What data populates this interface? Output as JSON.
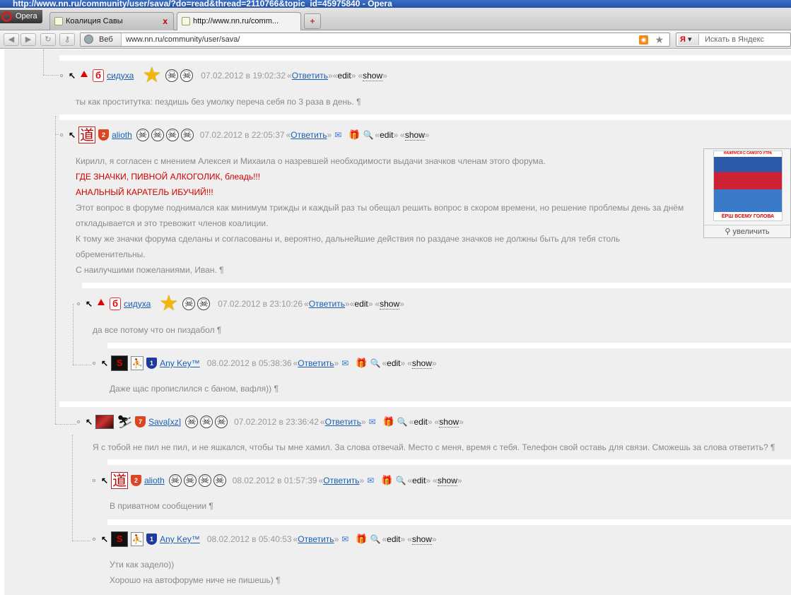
{
  "window": {
    "title": "http://www.nn.ru/community/user/sava/?do=read&thread=2110766&topic_id=45975840 - Opera"
  },
  "browser": {
    "opera_label": "Opera",
    "tabs": [
      {
        "label": "Коалиция Савы"
      },
      {
        "label": "http://www.nn.ru/comm..."
      }
    ],
    "tab_close": "x",
    "newtab": "+",
    "web_label": "Веб",
    "url": "www.nn.ru/community/user/sava/",
    "search_engine": "Я",
    "search_placeholder": "Искать в Яндекс"
  },
  "labels": {
    "reply": "Ответить",
    "edit": "edit",
    "show": "show",
    "q_open": "«",
    "q_close": "»",
    "pilcrow": "¶",
    "enlarge": "увеличить"
  },
  "posts": [
    {
      "author": "сидуха",
      "date": "07.02.2012 в 19:02:32",
      "lines": [
        "ты как проститутка: пездишь без умолку переча себя по 3 раза в день. ¶"
      ]
    },
    {
      "author": "alioth",
      "date": "07.02.2012 в 22:05:37",
      "lines": [
        "Кирилл, я согласен с мнением Алексея и Михаила о назревшей необходимости выдачи значков членам этого форума.",
        "ГДЕ ЗНАЧКИ, ПИВНОЙ АЛКОГОЛИК, блеадь!!!",
        "АНАЛЬНЫЙ КАРАТЕЛЬ ИБУЧИЙ!!!",
        "Этот вопрос в форуме поднимался как минимум трижды и каждый раз ты обещал решить вопрос в скором времени, но решение проблемы день за днём",
        "откладывается и это тревожит членов коалиции.",
        "К тому же значки форума сделаны и согласованы и, вероятно, дальнейшие действия по раздаче значков не должны быть для тебя столь",
        "обременительны.",
        "С наилучшими пожеланиями, Иван. ¶"
      ]
    },
    {
      "author": "сидуха",
      "date": "07.02.2012 в 23:10:26",
      "lines": [
        "да все потому что он пиздабол ¶"
      ]
    },
    {
      "author": "Any Key™",
      "date": "08.02.2012 в 05:38:36",
      "lines": [
        "Даже щас пропислился с баном, вафля)) ¶"
      ]
    },
    {
      "author": "Sava[xz]",
      "date": "07.02.2012 в 23:36:42",
      "lines": [
        "Я с тобой не пил не пил, и не яшкался, чтобы ты мне хамил. За слова отвечай. Место с меня, время с тебя. Телефон свой оставь для связи. Сможешь за слова ответить? ¶"
      ]
    },
    {
      "author": "alioth",
      "date": "08.02.2012 в 01:57:39",
      "lines": [
        "В приватном сообщении ¶"
      ]
    },
    {
      "author": "Any Key™",
      "date": "08.02.2012 в 05:40:53",
      "lines": [
        "Ути как задело))",
        "Хорошо на автофоруме ниче не пишешь) ¶"
      ]
    }
  ],
  "badges": {
    "six": "б",
    "tao": "道",
    "two": "2",
    "one": "1",
    "seven": "7",
    "sup": "S",
    "cs": "⛹"
  },
  "poster": {
    "top": "НАЖРИСЯ С САМОГО УТРА",
    "caption": "ЁРШ ВСЕМУ ГОЛОВА"
  },
  "colors": {
    "link": "#1a5fb4",
    "red_text": "#d00000",
    "meta": "#9a9a9a"
  }
}
